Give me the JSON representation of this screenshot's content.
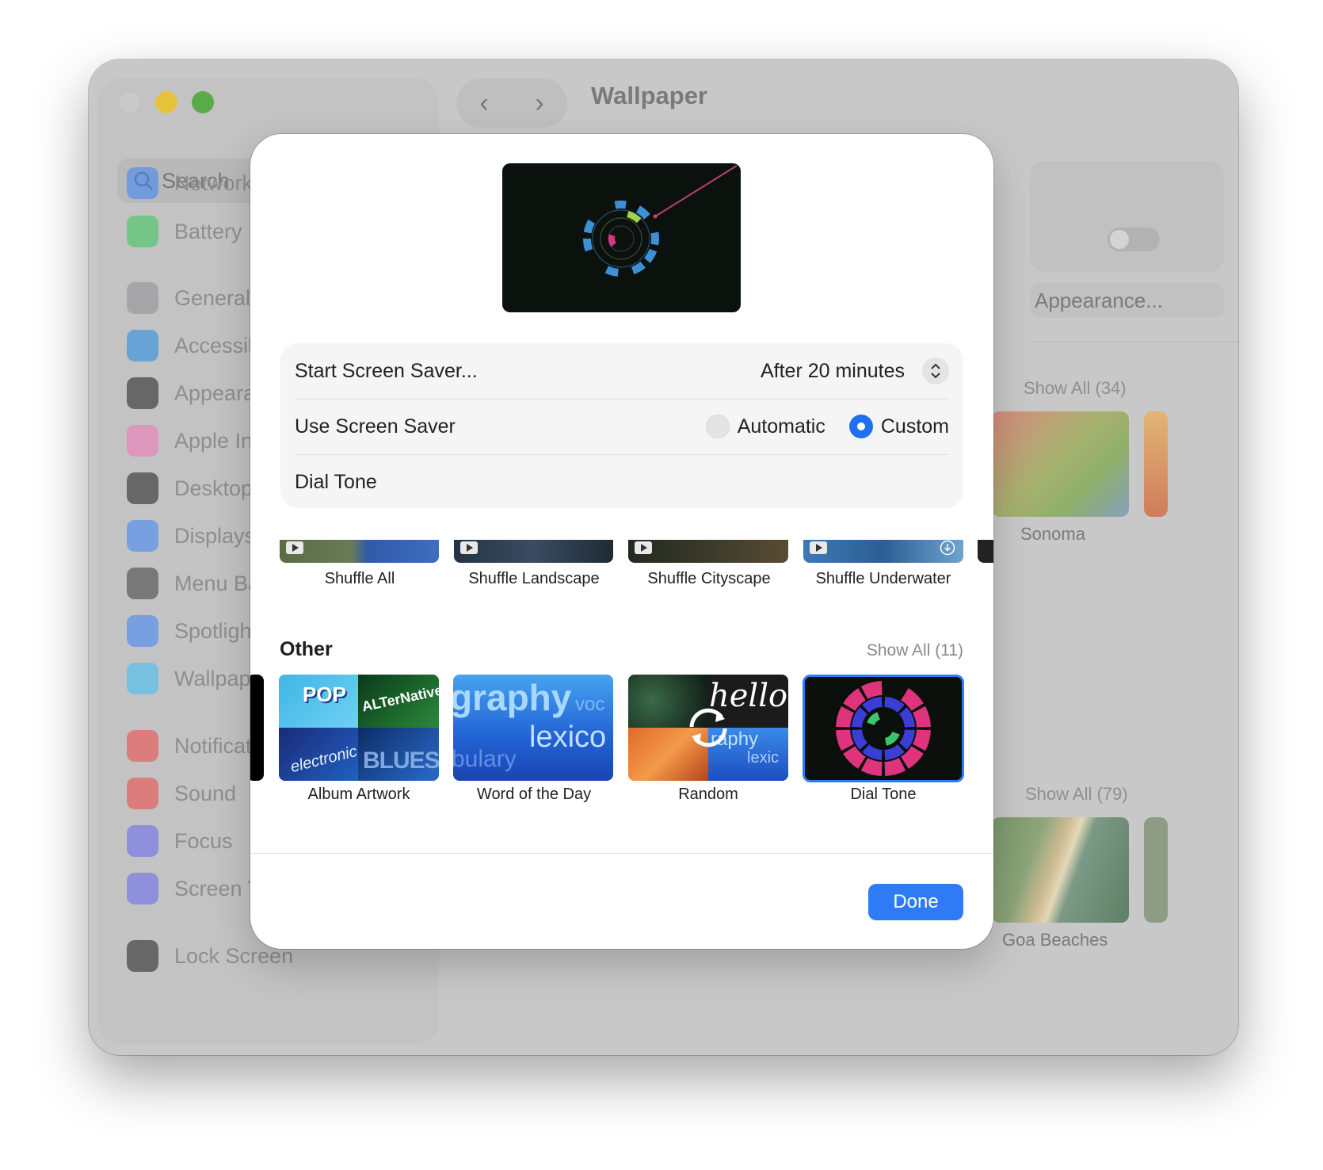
{
  "window": {
    "title": "Wallpaper",
    "search_placeholder": "Search",
    "nav_back": "‹",
    "nav_forward": "›"
  },
  "sidebar": {
    "items": [
      {
        "label": "Network",
        "color": "#3b82f6"
      },
      {
        "label": "Battery",
        "color": "#34c759"
      },
      {
        "label": "General",
        "color": "#8e8e93"
      },
      {
        "label": "Accessibili",
        "color": "#1e88e5"
      },
      {
        "label": "Appearanc",
        "color": "#1c1c1e"
      },
      {
        "label": "Apple Intel",
        "color": "#f472b6"
      },
      {
        "label": "Desktop &",
        "color": "#1c1c1e"
      },
      {
        "label": "Displays",
        "color": "#3b82f6"
      },
      {
        "label": "Menu Bar",
        "color": "#3a3a3c"
      },
      {
        "label": "Spotlight",
        "color": "#3b82f6"
      },
      {
        "label": "Wallpaper",
        "color": "#38bdf8"
      },
      {
        "label": "Notificatio",
        "color": "#ef4444"
      },
      {
        "label": "Sound",
        "color": "#ef4444"
      },
      {
        "label": "Focus",
        "color": "#6366f1"
      },
      {
        "label": "Screen Tin",
        "color": "#6366f1"
      },
      {
        "label": "Lock Screen",
        "color": "#1c1c1e"
      }
    ]
  },
  "background": {
    "appearance_button": "Appearance...",
    "show_all_1": "Show All (34)",
    "show_all_2": "Show All (79)",
    "caption_1": "Sonoma",
    "caption_2": "Goa Beaches"
  },
  "dialog": {
    "start_label": "Start Screen Saver...",
    "start_value": "After 20 minutes",
    "use_label": "Use Screen Saver",
    "radio_automatic": "Automatic",
    "radio_custom": "Custom",
    "radio_selected": "Custom",
    "selected_saver": "Dial Tone",
    "aerial_items": [
      "Shuffle All",
      "Shuffle Landscape",
      "Shuffle Cityscape",
      "Shuffle Underwater"
    ],
    "other_title": "Other",
    "other_show_all": "Show All (11)",
    "other_items": [
      "Album Artwork",
      "Word of the Day",
      "Random",
      "Dial Tone"
    ],
    "album_words": [
      "POP",
      "ALTerNative",
      "electronic",
      "BLUES"
    ],
    "word_text": [
      "graphy",
      "voc",
      "lexico",
      "bulary"
    ],
    "random_text": [
      "hello",
      "raphy",
      "lexic"
    ],
    "done_label": "Done"
  },
  "colors": {
    "accent": "#2f7bf5",
    "dial_pink": "#e0337d",
    "dial_blue": "#3a3dd6",
    "dial_green": "#3ec46d"
  }
}
